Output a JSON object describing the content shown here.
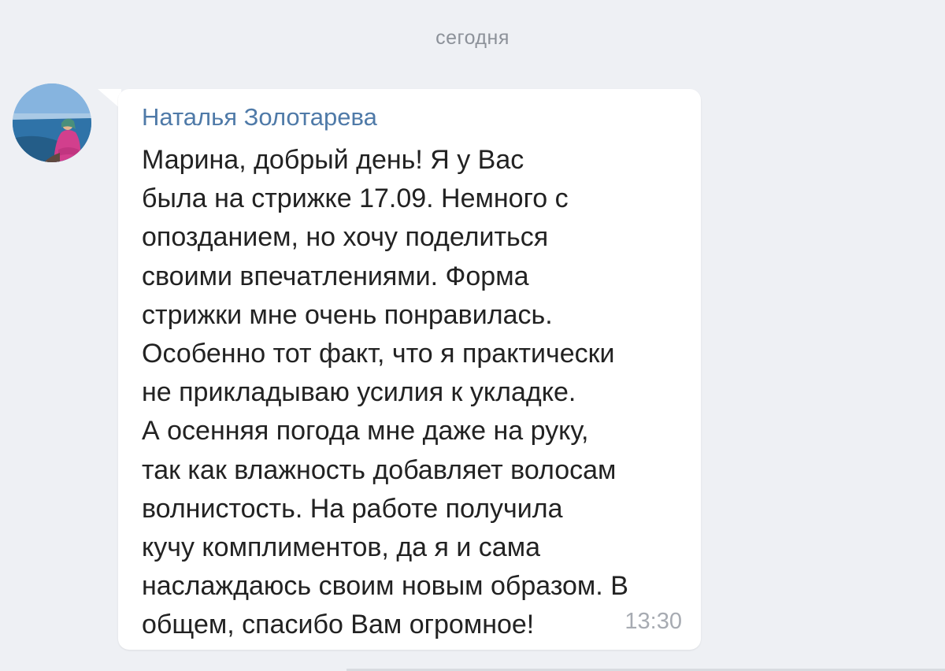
{
  "date_separator": "сегодня",
  "message": {
    "sender": "Наталья Золотарева",
    "lines": [
      "Марина, добрый день! Я у Вас",
      "была на стрижке 17.09. Немного с",
      "опозданием, но хочу поделиться",
      "своими впечатлениями. Форма",
      "стрижки мне очень понравилась.",
      "Особенно тот факт, что я практически",
      "не прикладываю усилия к укладке.",
      "А осенняя погода мне даже на руку,",
      "так как влажность добавляет волосам",
      "волнистость. На работе получила",
      "кучу комплиментов, да я и сама",
      "наслаждаюсь своим новым образом. В",
      "общем, спасибо Вам огромное!"
    ],
    "time": "13:30"
  },
  "colors": {
    "background": "#eef0f4",
    "bubble": "#ffffff",
    "sender_name": "#4f7aa8",
    "text": "#222222",
    "meta": "#a7abb2"
  }
}
